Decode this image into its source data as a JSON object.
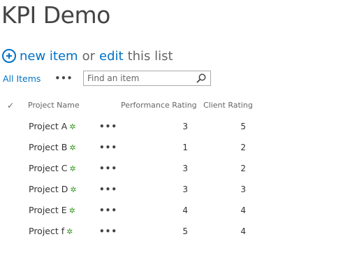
{
  "page": {
    "title": "KPI Demo"
  },
  "actions": {
    "new_item": "new item",
    "or": "or",
    "edit": "edit",
    "this_list": "this list"
  },
  "views": {
    "all_items": "All Items",
    "more": "•••"
  },
  "search": {
    "placeholder": "Find an item"
  },
  "table": {
    "check_header": "✓",
    "columns": {
      "project_name": "Project Name",
      "performance_rating": "Performance Rating",
      "client_rating": "Client Rating"
    },
    "row_menu": "•••",
    "new_badge": "✲",
    "rows": [
      {
        "name": "Project A",
        "performance": "3",
        "client": "5"
      },
      {
        "name": "Project B",
        "performance": "1",
        "client": "2"
      },
      {
        "name": "Project C",
        "performance": "3",
        "client": "2"
      },
      {
        "name": "Project D",
        "performance": "3",
        "client": "3"
      },
      {
        "name": "Project E",
        "performance": "4",
        "client": "4"
      },
      {
        "name": "Project f",
        "performance": "5",
        "client": "4"
      }
    ]
  },
  "colors": {
    "accent": "#0072c6",
    "new_badge": "#3a9a24",
    "text": "#444444"
  }
}
